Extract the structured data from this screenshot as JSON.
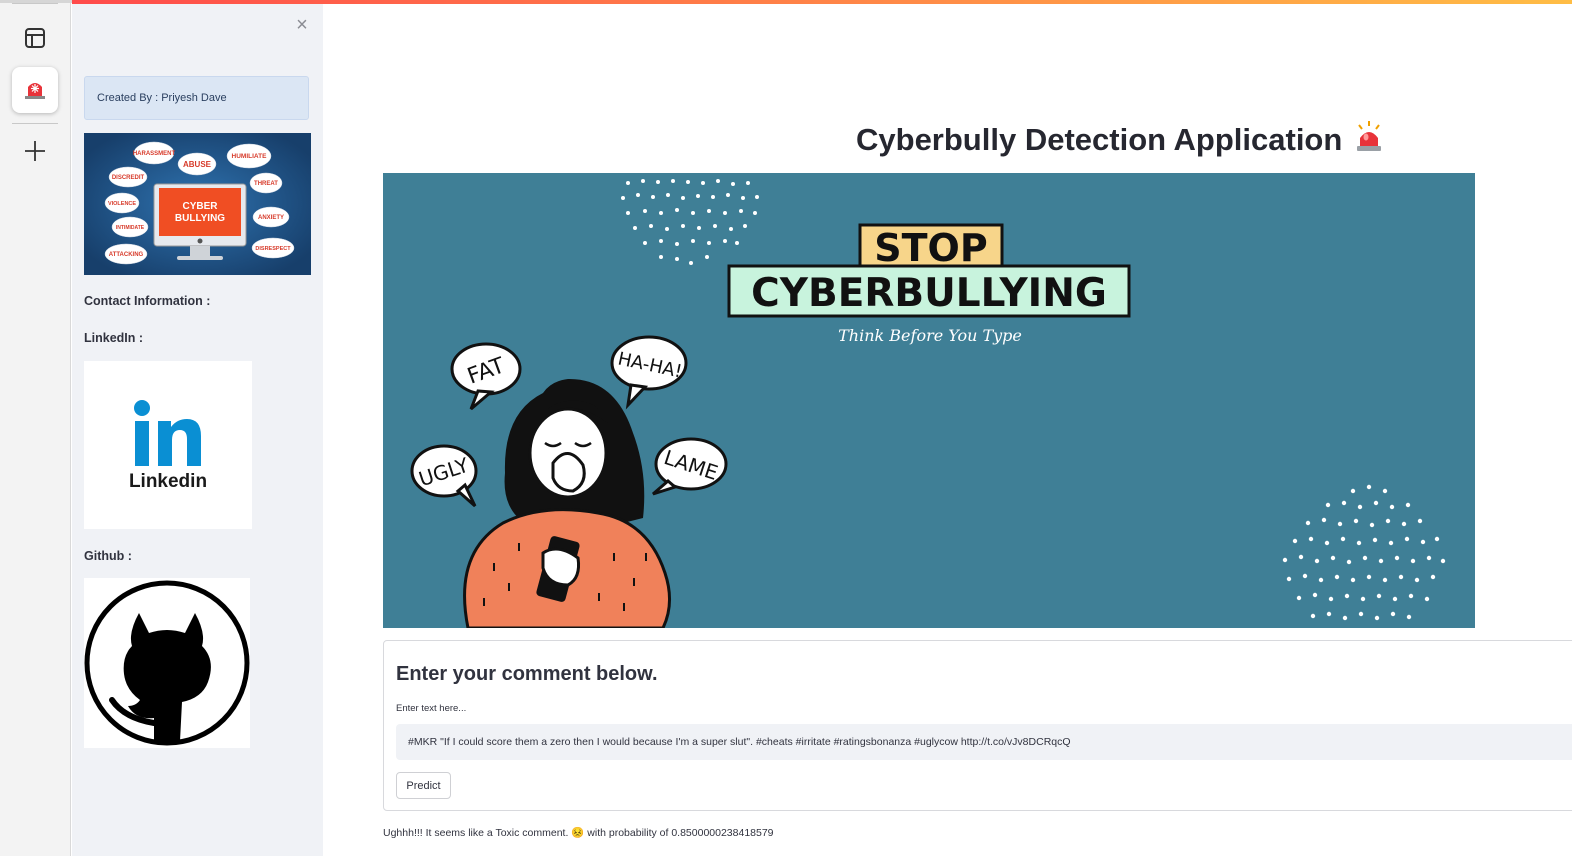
{
  "app": {
    "title": "Cyberbully Detection Application",
    "title_icon": "siren-icon"
  },
  "rail": {
    "icons": [
      "sidebar-toggle-icon",
      "siren-icon",
      "plus-icon"
    ]
  },
  "sidebar": {
    "close_label": "×",
    "created_by": "Created By : Priyesh Dave",
    "contact_label": "Contact Information :",
    "linkedin_label": "LinkedIn :",
    "linkedin_logo_text": "Linkedin",
    "github_label": "Github :",
    "cyber_image": {
      "screen_text": "CYBER BULLYING",
      "words": [
        "HARASSMENT",
        "ABUSE",
        "HUMILIATE",
        "DISCREDIT",
        "THREAT",
        "VIOLENCE",
        "ANXIETY",
        "INTIMIDATE",
        "DISRESPECT",
        "ATTACKING"
      ]
    }
  },
  "banner": {
    "stop": "STOP",
    "cyberbullying": "CYBERBULLYING",
    "tagline": "Think Before You Type",
    "bubbles": [
      "FAT",
      "HA-HA!",
      "UGLY",
      "LAME"
    ]
  },
  "form": {
    "title": "Enter your comment below.",
    "input_label": "Enter text here...",
    "input_value": "#MKR \"If I could score them a zero then I would because I'm a super slut\". #cheats #irritate #ratingsbonanza #uglycow http://t.co/vJv8DCRqcQ",
    "button_label": "Predict"
  },
  "result": {
    "text": "Ughhh!!! It seems like a Toxic comment. 😣 with probability of 0.8500000238418579"
  },
  "colors": {
    "accent_start": "#ff4b4b",
    "accent_end": "#ffbd45",
    "banner_bg": "#3f7f96",
    "sidebar_bg": "#f0f2f6",
    "linkedin_blue": "#0a8fd3"
  }
}
